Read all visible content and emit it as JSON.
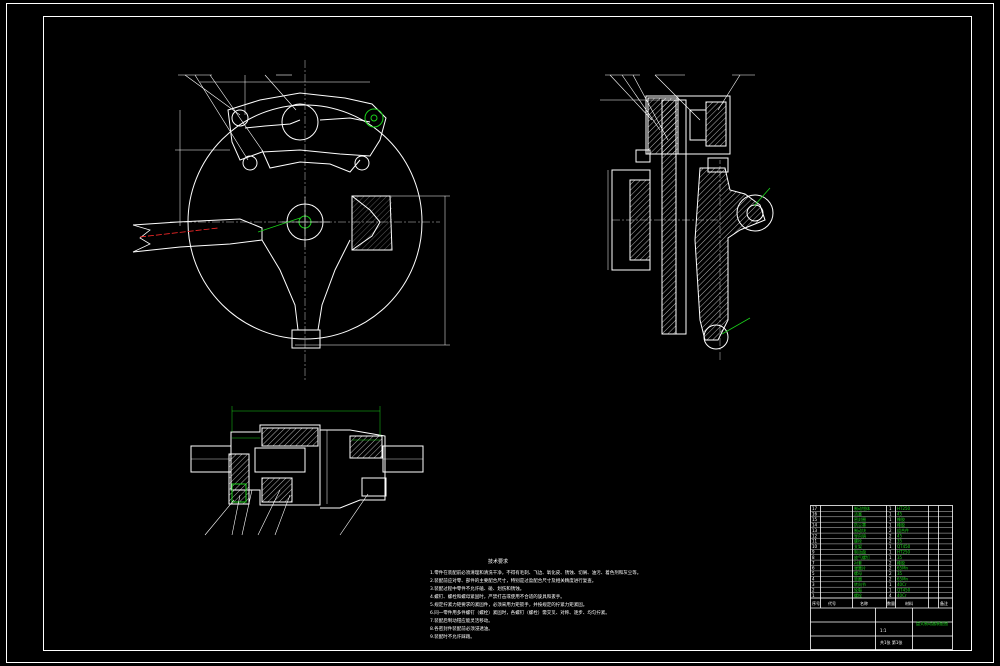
{
  "drawing": {
    "notes_title": "技术要求",
    "notes": [
      "1.零件在装配前必须清理和清洗干净，不得有毛刺、飞边、氧化皮、锈蚀、切屑、油污、着色剂和灰尘等。",
      "2.装配前应对零、部件的主要配合尺寸，特别是过盈配合尺寸及相关精度进行复查。",
      "3.装配过程中零件不允许磕、碰、划伤和锈蚀。",
      "4.螺钉、螺栓和螺母紧固时，严禁打击或使用不合适的旋具和扳手。",
      "5.规定拧紧力矩要求的紧固件，必须采用力矩扳手，并按规定的拧紧力矩紧固。",
      "6.同一零件用多件螺钉（螺栓）紧固时，各螺钉（螺栓）需交叉、对称、逐步、均匀拧紧。",
      "7.装配后制动钳应能灵活移动。",
      "8.各密封件装配前必须浸透油。",
      "9.装配时不允许踩踏。"
    ],
    "title_block": {
      "drawing_name": "盘式制动器装配图",
      "scale": "1:1",
      "sheet": "共1张 第1张",
      "header_labels": [
        "序号",
        "代号",
        "名称",
        "数量",
        "材料",
        "备注"
      ]
    },
    "bom_rows": [
      {
        "num": "17",
        "name": "制动钳体",
        "qty": "1",
        "mat": "HT250"
      },
      {
        "num": "16",
        "name": "活塞",
        "qty": "1",
        "mat": "45"
      },
      {
        "num": "15",
        "name": "密封圈",
        "qty": "1",
        "mat": "橡胶"
      },
      {
        "num": "14",
        "name": "防尘罩",
        "qty": "1",
        "mat": "橡胶"
      },
      {
        "num": "13",
        "name": "制动块",
        "qty": "2",
        "mat": "组合件"
      },
      {
        "num": "12",
        "name": "导向销",
        "qty": "2",
        "mat": "45"
      },
      {
        "num": "11",
        "name": "螺栓",
        "qty": "2",
        "mat": "35"
      },
      {
        "num": "10",
        "name": "支架",
        "qty": "1",
        "mat": "QT450"
      },
      {
        "num": "9",
        "name": "制动盘",
        "qty": "1",
        "mat": "HT250"
      },
      {
        "num": "8",
        "name": "放气螺钉",
        "qty": "1",
        "mat": "35"
      },
      {
        "num": "7",
        "name": "衬套",
        "qty": "2",
        "mat": "橡胶"
      },
      {
        "num": "6",
        "name": "弹簧片",
        "qty": "2",
        "mat": "65Mn"
      },
      {
        "num": "5",
        "name": "螺母",
        "qty": "2",
        "mat": "35"
      },
      {
        "num": "4",
        "name": "垫圈",
        "qty": "2",
        "mat": "65Mn"
      },
      {
        "num": "3",
        "name": "转向节",
        "qty": "1",
        "mat": "40Cr"
      },
      {
        "num": "2",
        "name": "轮毂",
        "qty": "1",
        "mat": "QT450"
      },
      {
        "num": "1",
        "name": "螺栓",
        "qty": "4",
        "mat": "40Cr"
      }
    ]
  },
  "colors": {
    "background": "#000000",
    "line": "#ffffff",
    "accent": "#1ad11a",
    "hatch": "#ffffff",
    "centerline": "#ff2a2a"
  }
}
